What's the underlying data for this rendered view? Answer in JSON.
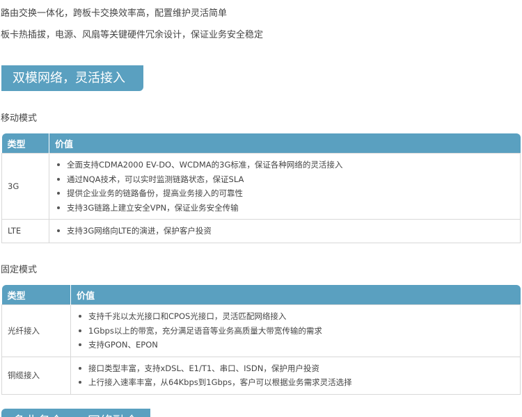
{
  "intro": {
    "line1": "路由交换一体化，跨板卡交换效率高，配置维护灵活简单",
    "line2": "板卡热插拔，电源、风扇等关键硬件冗余设计，保证业务安全稳定"
  },
  "section1": {
    "title": "双模网络，灵活接入"
  },
  "mobile": {
    "label": "移动模式",
    "headers": [
      "类型",
      "价值"
    ],
    "rows": [
      {
        "type": "3G",
        "items": [
          "全面支持CDMA2000 EV-DO、WCDMA的3G标准，保证各种网络的灵活接入",
          "通过NQA技术，可以实时监测链路状态，保证SLA",
          "提供企业业务的链路备份，提高业务接入的可靠性",
          "支持3G链路上建立安全VPN，保证业务安全传输"
        ]
      },
      {
        "type": "LTE",
        "items": [
          "支持3G网络向LTE的演进，保护客户投资"
        ]
      }
    ]
  },
  "fixed": {
    "label": "固定模式",
    "headers": [
      "类型",
      "价值"
    ],
    "rows": [
      {
        "type": "光纤接入",
        "items": [
          "支持千兆以太光接口和CPOS光接口，灵活匹配网络接入",
          "1Gbps以上的带宽，充分满足语音等业务高质量大带宽传输的需求",
          "支持GPON、EPON"
        ]
      },
      {
        "type": "铜缆接入",
        "items": [
          "接口类型丰富，支持xDSL、E1/T1、串口、ISDN，保护用户投资",
          "上行接入速率丰富，从64Kbps到1Gbps，客户可以根据业务需求灵活选择"
        ]
      }
    ]
  },
  "section2": {
    "title": "多业务合一，网络融合"
  }
}
